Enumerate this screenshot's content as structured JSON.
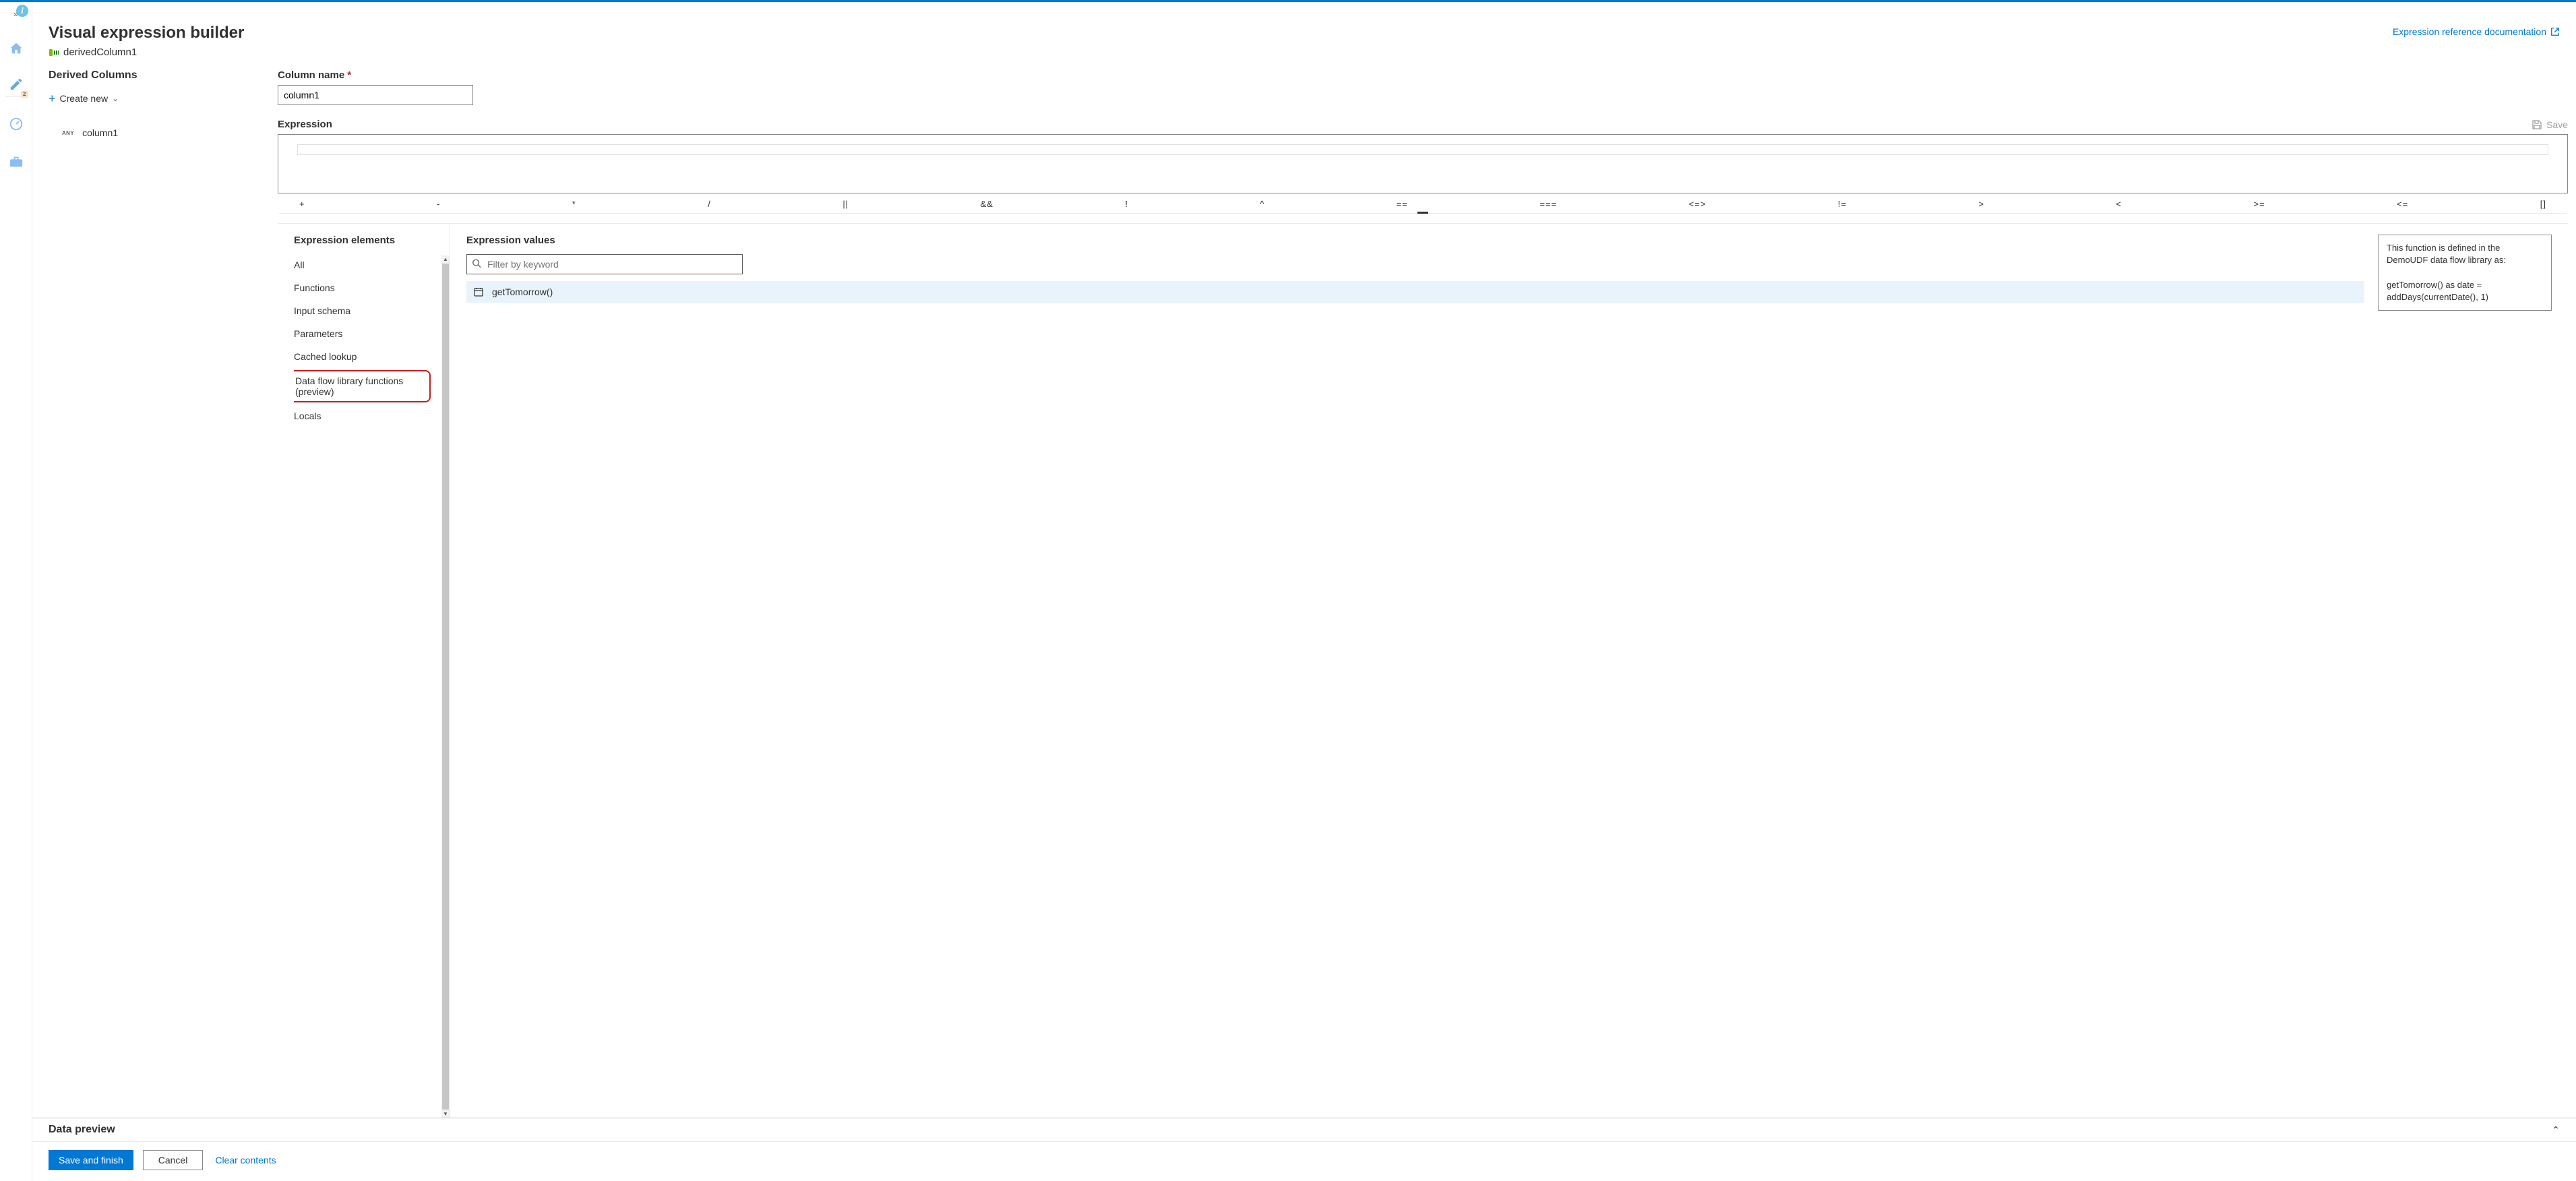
{
  "header": {
    "title": "Visual expression builder",
    "node_name": "derivedColumn1",
    "reference_link": "Expression reference documentation"
  },
  "derived_columns": {
    "title": "Derived Columns",
    "create_label": "Create new",
    "items": [
      {
        "type": "ANY",
        "name": "column1"
      }
    ]
  },
  "editor": {
    "column_name_label": "Column name",
    "column_name_value": "column1",
    "expression_label": "Expression",
    "save_label": "Save",
    "expression_value": ""
  },
  "operators": [
    "+",
    "-",
    "*",
    "/",
    "||",
    "&&",
    "!",
    "^",
    "==",
    "===",
    "<=>",
    "!=",
    ">",
    "<",
    ">=",
    "<=",
    "[]"
  ],
  "elements": {
    "title": "Expression elements",
    "items": [
      {
        "label": "All",
        "highlighted": false
      },
      {
        "label": "Functions",
        "highlighted": false
      },
      {
        "label": "Input schema",
        "highlighted": false
      },
      {
        "label": "Parameters",
        "highlighted": false
      },
      {
        "label": "Cached lookup",
        "highlighted": false
      },
      {
        "label": "Data flow library functions (preview)",
        "highlighted": true
      },
      {
        "label": "Locals",
        "highlighted": false
      }
    ]
  },
  "values": {
    "title": "Expression values",
    "filter_placeholder": "Filter by keyword",
    "items": [
      {
        "name": "getTomorrow()"
      }
    ],
    "tooltip": {
      "line1": "This function is defined in the DemoUDF data flow library as:",
      "line2": "getTomorrow() as date = addDays(currentDate(), 1)"
    }
  },
  "data_preview": {
    "label": "Data preview"
  },
  "footer": {
    "save_label": "Save and finish",
    "cancel_label": "Cancel",
    "clear_label": "Clear contents"
  },
  "left_rail": {
    "badge_count": "2"
  }
}
